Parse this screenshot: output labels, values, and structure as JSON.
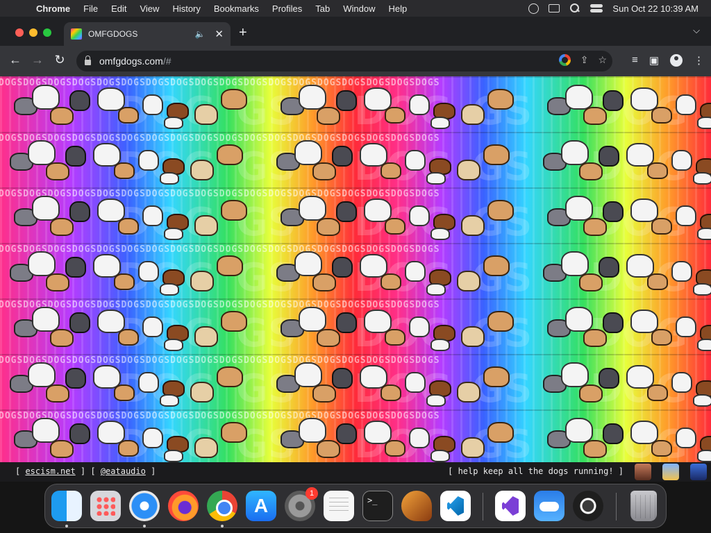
{
  "menubar": {
    "app": "Chrome",
    "items": [
      "File",
      "Edit",
      "View",
      "History",
      "Bookmarks",
      "Profiles",
      "Tab",
      "Window",
      "Help"
    ],
    "clock": "Sun Oct 22  10:39 AM"
  },
  "tab": {
    "title": "OMFGDOGS"
  },
  "address": {
    "domain": "omfgdogs.com",
    "path": "/#"
  },
  "page": {
    "pattern_word": "DOGSDOGSDOGSDOGSDOGSDOGSDOGSDOGSDOGSDOGSDOGSDOGSDOGSDOGSDOGSDOGSDOGSDOGS",
    "big_letters": [
      "DOG",
      "GS",
      "DOG",
      "GS",
      "DOG",
      "GS"
    ]
  },
  "footer": {
    "open1": "[ ",
    "link1": "escism.net",
    "sep": " ] [ ",
    "link2": "@eataudio",
    "close": " ]",
    "right": "[ help keep all the dogs running! ]"
  },
  "dock": {
    "settings_badge": "1",
    "terminal_prompt": ">_",
    "appstore_glyph": "A"
  },
  "colors": {
    "menubar": "#2b2b2e",
    "tabstrip": "#202124",
    "toolbar": "#35363a",
    "footer": "#1b1b1d"
  }
}
